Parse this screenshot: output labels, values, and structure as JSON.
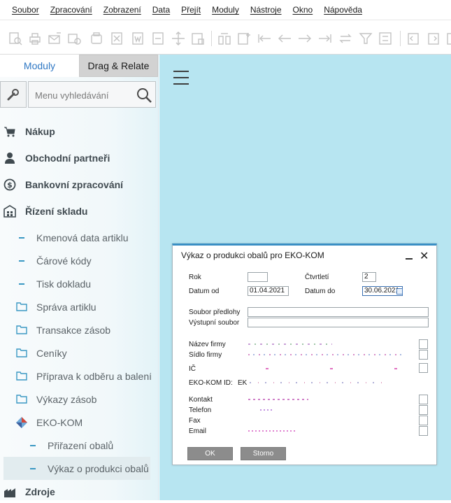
{
  "menu": [
    "Soubor",
    "Zpracování",
    "Zobrazení",
    "Data",
    "Přejít",
    "Moduly",
    "Nástroje",
    "Okno",
    "Nápověda"
  ],
  "sidebar": {
    "tabs": [
      {
        "label": "Moduly",
        "active": true
      },
      {
        "label": "Drag & Relate",
        "active": false
      }
    ],
    "search_placeholder": "Menu vyhledávání",
    "items": [
      {
        "label": "Nákup",
        "level": 0,
        "icon": "cart-icon"
      },
      {
        "label": "Obchodní partneři",
        "level": 0,
        "icon": "person-icon"
      },
      {
        "label": "Bankovní zpracování",
        "level": 0,
        "icon": "dollar-icon"
      },
      {
        "label": "Řízení skladu",
        "level": 0,
        "icon": "warehouse-icon"
      },
      {
        "label": "Kmenová data artiklu",
        "level": 1,
        "icon": "dash"
      },
      {
        "label": "Čárové kódy",
        "level": 1,
        "icon": "dash"
      },
      {
        "label": "Tisk dokladu",
        "level": 1,
        "icon": "dash"
      },
      {
        "label": "Správa artiklu",
        "level": 1,
        "icon": "folder-icon"
      },
      {
        "label": "Transakce zásob",
        "level": 1,
        "icon": "folder-icon"
      },
      {
        "label": "Ceníky",
        "level": 1,
        "icon": "folder-icon"
      },
      {
        "label": "Příprava k odběru a balení",
        "level": 1,
        "icon": "folder-icon"
      },
      {
        "label": "Výkazy zásob",
        "level": 1,
        "icon": "folder-icon"
      },
      {
        "label": "EKO-KOM",
        "level": 1,
        "icon": "addon-icon"
      },
      {
        "label": "Přiřazení obalů",
        "level": 2,
        "icon": "dash"
      },
      {
        "label": "Výkaz o produkci obalů",
        "level": 2,
        "icon": "dash",
        "selected": true
      },
      {
        "label": "Zdroje",
        "level": 0,
        "icon": "factory-icon"
      }
    ]
  },
  "dialog": {
    "title": "Výkaz o produkci obalů pro EKO-KOM",
    "rok_label": "Rok",
    "rok_value": "",
    "ctvrtleti_label": "Čtvrtletí",
    "ctvrtleti_value": "2",
    "datum_od_label": "Datum od",
    "datum_od_value": "01.04.2021",
    "datum_do_label": "Datum do",
    "datum_do_value": "30.06.2021",
    "soubor_predlohy_label": "Soubor předlohy",
    "soubor_predlohy_value": "",
    "vystupni_soubor_label": "Výstupní soubor",
    "vystupni_soubor_value": "",
    "nazev_firmy_label": "Název firmy",
    "sidlo_firmy_label": "Sídlo firmy",
    "ic_label": "IČ",
    "ekokom_id_label": "EKO-KOM ID:",
    "ekokom_id_value": "EK",
    "kontakt_label": "Kontakt",
    "telefon_label": "Telefon",
    "fax_label": "Fax",
    "email_label": "Email",
    "ok_label": "OK",
    "storno_label": "Storno"
  },
  "colors": {
    "accent": "#3a8fc4",
    "workspace": "#b7e5f1",
    "tab_active_text": "#2f78c4"
  }
}
